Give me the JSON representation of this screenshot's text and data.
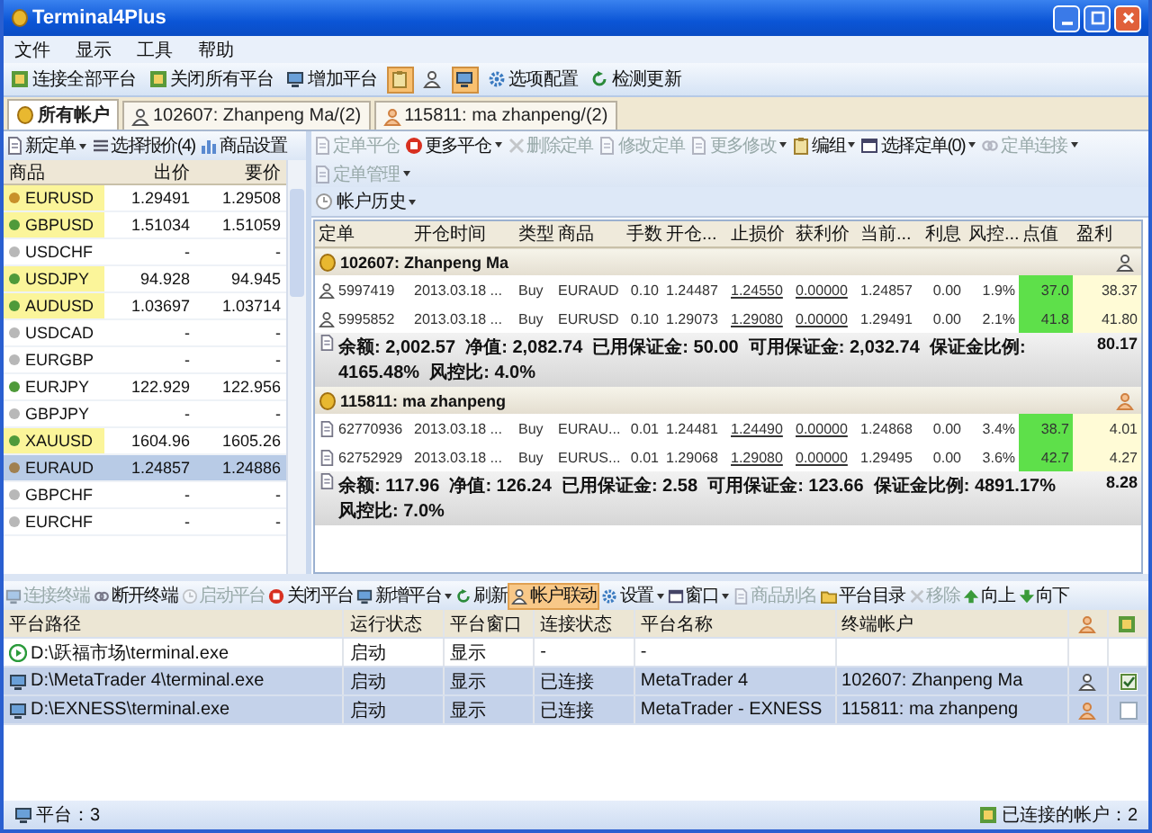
{
  "window": {
    "title": "Terminal4Plus"
  },
  "menu": [
    "文件",
    "显示",
    "工具",
    "帮助"
  ],
  "main_toolbar": [
    {
      "kind": "button",
      "label": "连接全部平台"
    },
    {
      "kind": "button",
      "label": "关闭所有平台"
    },
    {
      "kind": "button",
      "label": "增加平台"
    },
    {
      "kind": "icon",
      "on": true
    },
    {
      "kind": "icon",
      "on": false
    },
    {
      "kind": "icon",
      "on": true
    },
    {
      "kind": "button",
      "label": "选项配置"
    },
    {
      "kind": "button",
      "label": "检测更新"
    }
  ],
  "tabs": [
    {
      "label": "所有帐户",
      "selected": true
    },
    {
      "label": "102607: Zhanpeng Ma/(2)",
      "selected": false
    },
    {
      "label": "115811: ma zhanpeng/(2)",
      "selected": false
    }
  ],
  "quotes_toolbar": [
    {
      "label": "新定单",
      "dropdown": true
    },
    {
      "label": "选择报价(4)",
      "dropdown": false
    },
    {
      "label": "商品设置",
      "dropdown": false
    }
  ],
  "quotes": {
    "columns": [
      "商品",
      "出价",
      "要价"
    ],
    "rows": [
      {
        "symbol": "EURUSD",
        "bid": "1.29491",
        "ask": "1.29508",
        "color": "#c8902a",
        "highlighted": true,
        "selected": false
      },
      {
        "symbol": "GBPUSD",
        "bid": "1.51034",
        "ask": "1.51059",
        "color": "#4f9a3a",
        "highlighted": true,
        "selected": false
      },
      {
        "symbol": "USDCHF",
        "bid": "-",
        "ask": "-",
        "color": "#b8b8b8",
        "highlighted": false,
        "selected": false
      },
      {
        "symbol": "USDJPY",
        "bid": "94.928",
        "ask": "94.945",
        "color": "#4f9a3a",
        "highlighted": true,
        "selected": false
      },
      {
        "symbol": "AUDUSD",
        "bid": "1.03697",
        "ask": "1.03714",
        "color": "#4f9a3a",
        "highlighted": true,
        "selected": false
      },
      {
        "symbol": "USDCAD",
        "bid": "-",
        "ask": "-",
        "color": "#b8b8b8",
        "highlighted": false,
        "selected": false
      },
      {
        "symbol": "EURGBP",
        "bid": "-",
        "ask": "-",
        "color": "#b8b8b8",
        "highlighted": false,
        "selected": false
      },
      {
        "symbol": "EURJPY",
        "bid": "122.929",
        "ask": "122.956",
        "color": "#4f9a3a",
        "highlighted": false,
        "selected": false
      },
      {
        "symbol": "GBPJPY",
        "bid": "-",
        "ask": "-",
        "color": "#b8b8b8",
        "highlighted": false,
        "selected": false
      },
      {
        "symbol": "XAUUSD",
        "bid": "1604.96",
        "ask": "1605.26",
        "color": "#4f9a3a",
        "highlighted": true,
        "selected": false
      },
      {
        "symbol": "EURAUD",
        "bid": "1.24857",
        "ask": "1.24886",
        "color": "#a08050",
        "highlighted": false,
        "selected": true
      },
      {
        "symbol": "GBPCHF",
        "bid": "-",
        "ask": "-",
        "color": "#b8b8b8",
        "highlighted": false,
        "selected": false
      },
      {
        "symbol": "EURCHF",
        "bid": "-",
        "ask": "-",
        "color": "#b8b8b8",
        "highlighted": false,
        "selected": false
      }
    ]
  },
  "orders_toolbar": [
    {
      "label": "定单平仓",
      "dropdown": false,
      "disabled": true
    },
    {
      "label": "更多平仓",
      "dropdown": true,
      "disabled": false
    },
    {
      "label": "删除定单",
      "dropdown": false,
      "disabled": true
    },
    {
      "label": "修改定单",
      "dropdown": false,
      "disabled": true
    },
    {
      "label": "更多修改",
      "dropdown": true,
      "disabled": true
    },
    {
      "label": "编组",
      "dropdown": true,
      "disabled": false
    },
    {
      "label": "选择定单(0)",
      "dropdown": true,
      "disabled": false
    },
    {
      "label": "定单连接",
      "dropdown": true,
      "disabled": true
    },
    {
      "label": "定单管理",
      "dropdown": true,
      "disabled": true
    }
  ],
  "history_button": {
    "label": "帐户历史"
  },
  "orders": {
    "columns": [
      "定单",
      "开仓时间",
      "类型",
      "商品",
      "手数",
      "开仓...",
      "止损价",
      "获利价",
      "当前...",
      "利息",
      "风控...",
      "点值",
      "盈利"
    ],
    "groups": [
      {
        "account": "102607: Zhanpeng Ma",
        "rows": [
          {
            "order": "5997419",
            "open_time": "2013.03.18 ...",
            "type": "Buy",
            "symbol": "EURAUD",
            "lots": "0.10",
            "open_price": "1.24487",
            "stop_loss": "1.24550",
            "take_profit": "0.00000",
            "current": "1.24857",
            "swap": "0.00",
            "risk": "1.9%",
            "points": "37.0",
            "profit": "38.37"
          },
          {
            "order": "5995852",
            "open_time": "2013.03.18 ...",
            "type": "Buy",
            "symbol": "EURUSD",
            "lots": "0.10",
            "open_price": "1.29073",
            "stop_loss": "1.29080",
            "take_profit": "0.00000",
            "current": "1.29491",
            "swap": "0.00",
            "risk": "2.1%",
            "points": "41.8",
            "profit": "41.80"
          }
        ],
        "summary": "余额: 2,002.57  净值: 2,082.74  已用保证金: 50.00  可用保证金: 2,032.74  保证金比例: 4165.48%  风控比: 4.0%",
        "total_profit": "80.17"
      },
      {
        "account": "115811: ma zhanpeng",
        "rows": [
          {
            "order": "62770936",
            "open_time": "2013.03.18 ...",
            "type": "Buy",
            "symbol": "EURAU...",
            "lots": "0.01",
            "open_price": "1.24481",
            "stop_loss": "1.24490",
            "take_profit": "0.00000",
            "current": "1.24868",
            "swap": "0.00",
            "risk": "3.4%",
            "points": "38.7",
            "profit": "4.01"
          },
          {
            "order": "62752929",
            "open_time": "2013.03.18 ...",
            "type": "Buy",
            "symbol": "EURUS...",
            "lots": "0.01",
            "open_price": "1.29068",
            "stop_loss": "1.29080",
            "take_profit": "0.00000",
            "current": "1.29495",
            "swap": "0.00",
            "risk": "3.6%",
            "points": "42.7",
            "profit": "4.27"
          }
        ],
        "summary": "余额: 117.96  净值: 126.24  已用保证金: 2.58  可用保证金: 123.66  保证金比例: 4891.17%  风控比: 7.0%",
        "total_profit": "8.28"
      }
    ]
  },
  "platform_toolbar": [
    {
      "label": "连接终端",
      "disabled": true,
      "dropdown": false,
      "on": false
    },
    {
      "label": "断开终端",
      "disabled": false,
      "dropdown": false,
      "on": false
    },
    {
      "label": "启动平台",
      "disabled": true,
      "dropdown": false,
      "on": false
    },
    {
      "label": "关闭平台",
      "disabled": false,
      "dropdown": false,
      "on": false
    },
    {
      "label": "新增平台",
      "disabled": false,
      "dropdown": true,
      "on": false
    },
    {
      "label": "刷新",
      "disabled": false,
      "dropdown": false,
      "on": false
    },
    {
      "label": "帐户联动",
      "disabled": false,
      "dropdown": false,
      "on": true
    },
    {
      "label": "设置",
      "disabled": false,
      "dropdown": true,
      "on": false
    },
    {
      "label": "窗口",
      "disabled": false,
      "dropdown": true,
      "on": false
    },
    {
      "label": "商品别名",
      "disabled": true,
      "dropdown": false,
      "on": false
    },
    {
      "label": "平台目录",
      "disabled": false,
      "dropdown": false,
      "on": false
    },
    {
      "label": "移除",
      "disabled": true,
      "dropdown": false,
      "on": false
    },
    {
      "label": "向上",
      "disabled": false,
      "dropdown": false,
      "on": false
    },
    {
      "label": "向下",
      "disabled": false,
      "dropdown": false,
      "on": false
    }
  ],
  "platforms": {
    "columns": [
      "平台路径",
      "运行状态",
      "平台窗口",
      "连接状态",
      "平台名称",
      "终端帐户"
    ],
    "rows": [
      {
        "kind": "local",
        "path": "D:\\跃福市场\\terminal.exe",
        "run_state": "启动",
        "window": "显示",
        "connection": "-",
        "name": "-",
        "account": "",
        "selected": false
      },
      {
        "kind": "account",
        "path": "D:\\MetaTrader 4\\terminal.exe",
        "run_state": "启动",
        "window": "显示",
        "connection": "已连接",
        "name": "MetaTrader 4",
        "account": "102607: Zhanpeng Ma",
        "selected": true,
        "checked": true
      },
      {
        "kind": "account",
        "path": "D:\\EXNESS\\terminal.exe",
        "run_state": "启动",
        "window": "显示",
        "connection": "已连接",
        "name": "MetaTrader - EXNESS",
        "account": "115811: ma zhanpeng",
        "selected": true,
        "checked": false
      }
    ]
  },
  "status_bar": {
    "platforms": "平台：3",
    "connected": "已连接的帐户：2"
  }
}
